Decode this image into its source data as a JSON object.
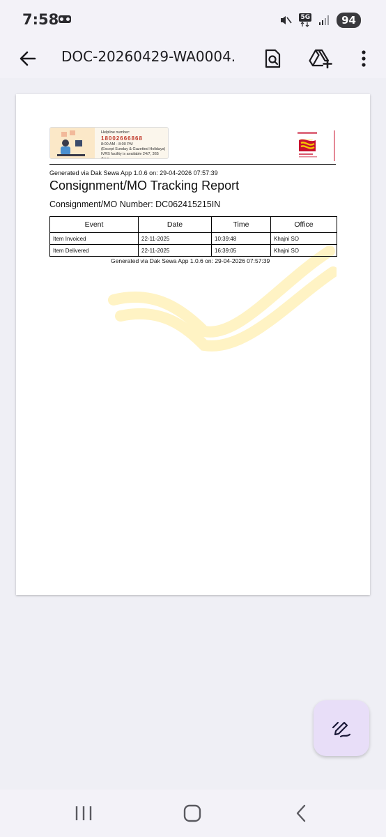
{
  "status_bar": {
    "time": "7:58",
    "network_label": "5G",
    "battery": "94"
  },
  "app_bar": {
    "title": "DOC-20260429-WA0004.",
    "icons": [
      "back-arrow-icon",
      "search-document-icon",
      "save-to-drive-icon",
      "more-vert-icon"
    ]
  },
  "document": {
    "helpline": {
      "label": "Helpline number:",
      "number": "18002666868",
      "hours": "8:00 AM - 8:00 PM",
      "note": "(Except Sunday & Gazetted Holidays)",
      "ivrs": "IVRS facility is available 24/7, 365 days."
    },
    "generated_top": "Generated via Dak Sewa App 1.0.6 on: 29-04-2026 07:57:39",
    "report_title": "Consignment/MO Tracking Report",
    "consignment_line": "Consignment/MO Number: DC062415215IN",
    "table": {
      "headers": [
        "Event",
        "Date",
        "Time",
        "Office"
      ],
      "rows": [
        [
          "Item Invoiced",
          "22-11-2025",
          "10:39:48",
          "Khajni SO"
        ],
        [
          "Item Delivered",
          "22-11-2025",
          "16:39:05",
          "Khajni SO"
        ]
      ]
    },
    "generated_bottom": "Generated via Dak Sewa App 1.0.6 on: 29-04-2026 07:57:39",
    "watermark_color": "#fff3c4",
    "logo_color": "#c8102e"
  },
  "fab": {
    "icon": "edit-pen-icon",
    "color": "#e8def8"
  },
  "nav_bar": {
    "icons": [
      "recents-icon",
      "home-icon",
      "nav-back-icon"
    ]
  }
}
